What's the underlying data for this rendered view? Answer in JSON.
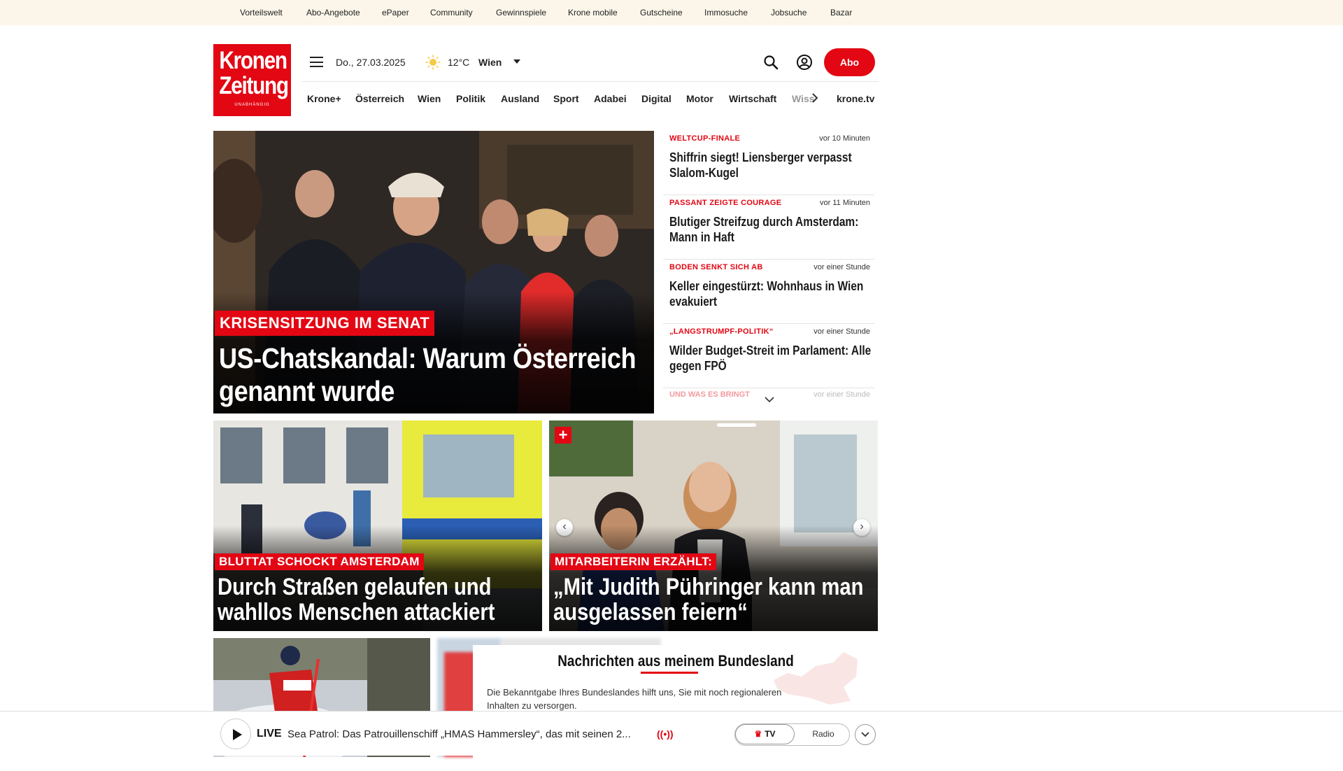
{
  "topnav": [
    "Vorteilswelt",
    "Abo-Angebote",
    "ePaper",
    "Community",
    "Gewinnspiele",
    "Krone mobile",
    "Gutscheine",
    "Immosuche",
    "Jobsuche",
    "Bazar"
  ],
  "logo": {
    "line1": "Kronen",
    "line2": "Zeitung",
    "tagline": "UNABHÄNGIG"
  },
  "header": {
    "date": "Do., 27.03.2025",
    "temperature": "12°C",
    "city": "Wien",
    "abo_label": "Abo"
  },
  "nav": {
    "items": [
      "Krone+",
      "Österreich",
      "Wien",
      "Politik",
      "Ausland",
      "Sport",
      "Adabei",
      "Digital",
      "Motor",
      "Wirtschaft"
    ],
    "faded": "Wiss",
    "tv": "krone.tv"
  },
  "hero": {
    "kicker": "KRISENSITZUNG IM SENAT",
    "title": "US-Chatskandal: Warum Österreich genannt wurde"
  },
  "ticker": [
    {
      "kicker": "WELTCUP-FINALE",
      "time": "vor 10 Minuten",
      "headline": "Shiffrin siegt! Liensberger verpasst Slalom-Kugel"
    },
    {
      "kicker": "PASSANT ZEIGTE COURAGE",
      "time": "vor 11 Minuten",
      "headline": "Blutiger Streifzug durch Amsterdam: Mann in Haft"
    },
    {
      "kicker": "BODEN SENKT SICH AB",
      "time": "vor einer Stunde",
      "headline": "Keller eingestürzt: Wohnhaus in Wien evakuiert"
    },
    {
      "kicker": "„LANGSTRUMPF-POLITIK“",
      "time": "vor einer Stunde",
      "headline": "Wilder Budget-Streit im Parlament: Alle gegen FPÖ"
    }
  ],
  "ticker_faded": {
    "kicker": "UND WAS ES BRINGT",
    "time": "vor einer Stunde"
  },
  "cards": [
    {
      "kicker": "BLUTTAT SCHOCKT AMSTERDAM",
      "title": "Durch Straßen gelaufen und wahllos Menschen attackiert"
    },
    {
      "kicker": "MITARBEITERIN ERZÄHLT:",
      "title": "„Mit Judith Pühringer kann man ausgelassen feiern“",
      "badge": "+"
    }
  ],
  "bundesland": {
    "title": "Nachrichten aus meinem Bundesland",
    "text": "Die Bekanntgabe Ihres Bundeslandes hilft uns, Sie mit noch regionaleren Inhalten zu versorgen."
  },
  "player": {
    "live": "LIVE",
    "text": "Sea Patrol: Das Patrouillenschiff „HMAS Hammersley“, das mit seinen 2...",
    "radio_icon": "((•))",
    "tv": "TV",
    "radio": "Radio"
  },
  "colors": {
    "brand_red": "#e30613",
    "topbar_bg": "#fbf6e9"
  }
}
